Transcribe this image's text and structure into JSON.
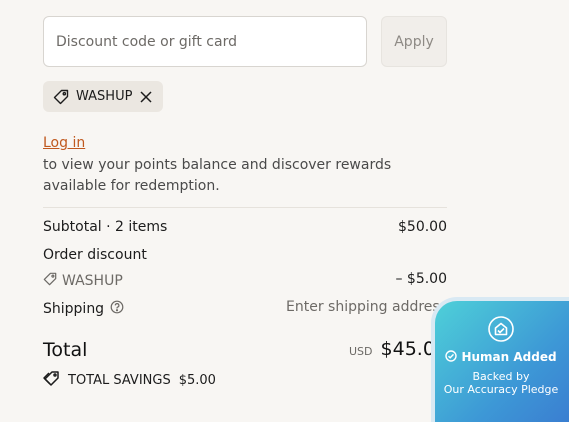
{
  "discount": {
    "placeholder": "Discount code or gift card",
    "apply_label": "Apply",
    "applied_code": "WASHUP"
  },
  "login": {
    "link_text": "Log in",
    "description": "to view your points balance and discover rewards available for redemption."
  },
  "summary": {
    "subtotal_label": "Subtotal · 2 items",
    "subtotal_value": "$50.00",
    "order_discount_label": "Order discount",
    "discount_code": "WASHUP",
    "discount_value": "– $5.00",
    "shipping_label": "Shipping",
    "shipping_value": "Enter shipping address",
    "total_label": "Total",
    "currency": "USD",
    "total_value": "$45.00",
    "savings_label": "TOTAL SAVINGS",
    "savings_value": "$5.00"
  },
  "badge": {
    "title": "Human Added",
    "line1": "Backed by",
    "line2": "Our Accuracy Pledge"
  },
  "colors": {
    "link": "#c0591f",
    "badge_gradient_start": "#4ed0d8",
    "badge_gradient_end": "#3a7bd0"
  },
  "icons": [
    "tag-icon",
    "close-icon",
    "help-circle-icon",
    "savings-tag-icon",
    "shield-house-icon",
    "check-circle-icon"
  ]
}
